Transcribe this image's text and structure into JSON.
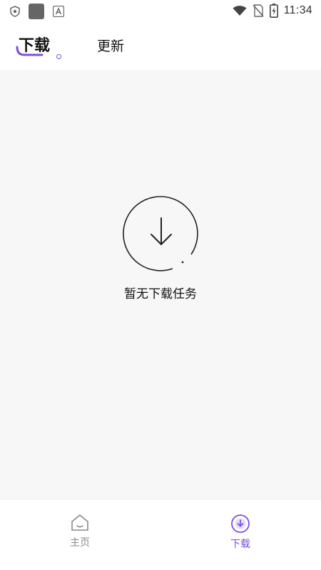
{
  "status_bar": {
    "time": "11:34",
    "icons": [
      "shield-icon",
      "app-square-icon",
      "a-badge-icon",
      "wifi-icon",
      "no-sim-icon",
      "battery-charging-icon"
    ]
  },
  "header": {
    "tabs": [
      {
        "label": "下载",
        "active": true
      },
      {
        "label": "更新",
        "active": false
      }
    ],
    "accent_color": "#7b4fe0"
  },
  "main": {
    "empty_icon": "download-arrow-circle-icon",
    "empty_text": "暂无下载任务",
    "background": "#f7f7f7"
  },
  "bottom_nav": {
    "items": [
      {
        "label": "主页",
        "icon": "home-icon",
        "active": false
      },
      {
        "label": "下载",
        "icon": "download-icon",
        "active": true
      }
    ]
  }
}
